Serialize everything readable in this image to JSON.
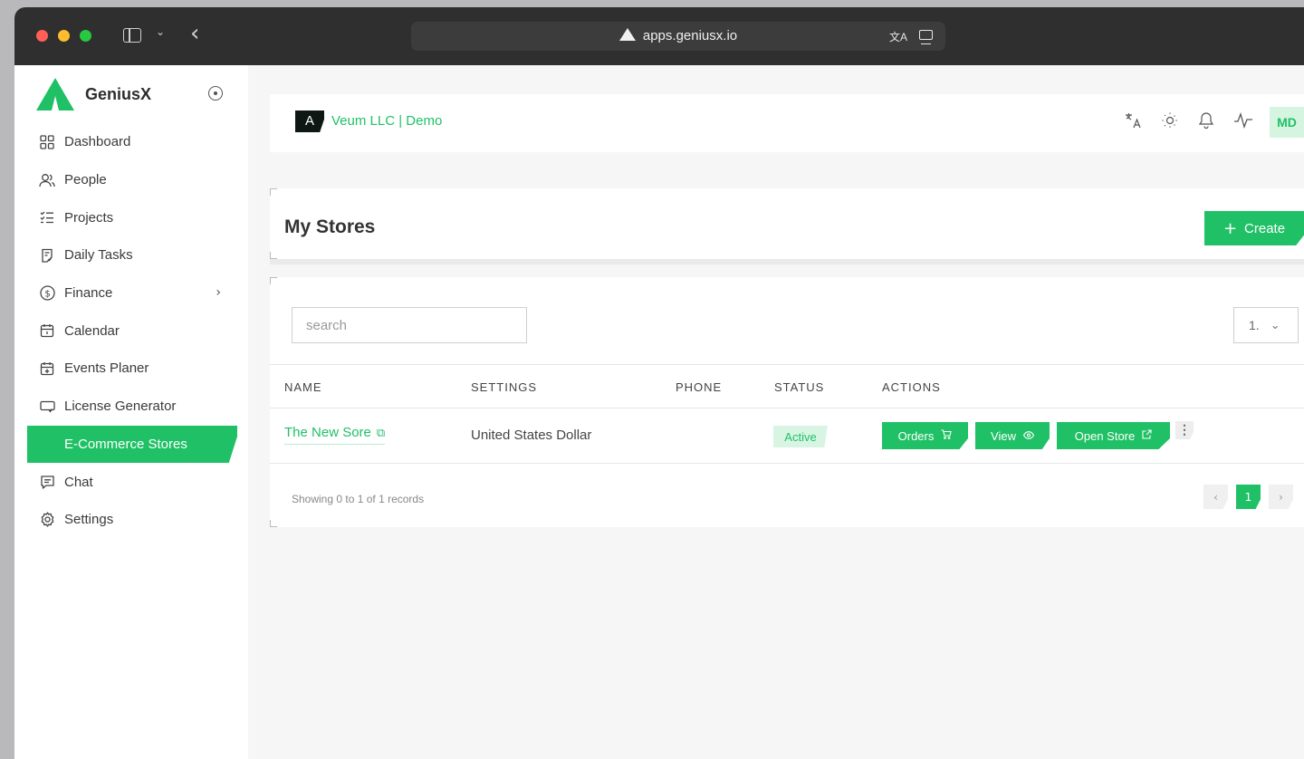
{
  "browser": {
    "url": "apps.geniusx.io"
  },
  "sidebar": {
    "brand": "GeniusX",
    "items": [
      {
        "label": "Dashboard",
        "icon": "grid-icon"
      },
      {
        "label": "People",
        "icon": "users-icon"
      },
      {
        "label": "Projects",
        "icon": "checklist-icon"
      },
      {
        "label": "Daily Tasks",
        "icon": "clipboard-icon"
      },
      {
        "label": "Finance",
        "icon": "dollar-icon"
      },
      {
        "label": "Calendar",
        "icon": "calendar-icon"
      },
      {
        "label": "Events Planer",
        "icon": "calendar-plus-icon"
      },
      {
        "label": "License Generator",
        "icon": "monitor-icon"
      },
      {
        "label": "E-Commerce Stores",
        "icon": ""
      },
      {
        "label": "Chat",
        "icon": "chat-icon"
      },
      {
        "label": "Settings",
        "icon": "gear-icon"
      }
    ]
  },
  "topbar": {
    "org_name": "Veum LLC | Demo",
    "avatar_initials": "MD"
  },
  "page": {
    "title": "My Stores",
    "create_label": "Create"
  },
  "table": {
    "search_placeholder": "search",
    "per_page": "1.",
    "columns": [
      "NAME",
      "SETTINGS",
      "PHONE",
      "STATUS",
      "ACTIONS"
    ],
    "rows": [
      {
        "name": "The New Sore",
        "settings": "United States Dollar",
        "phone": "",
        "status": "Active",
        "actions": [
          "Orders",
          "View",
          "Open Store"
        ]
      }
    ],
    "footer": "Showing 0 to 1 of 1 records",
    "current_page": "1"
  },
  "colors": {
    "accent": "#20c166",
    "accent_light": "#d8f5e3"
  }
}
